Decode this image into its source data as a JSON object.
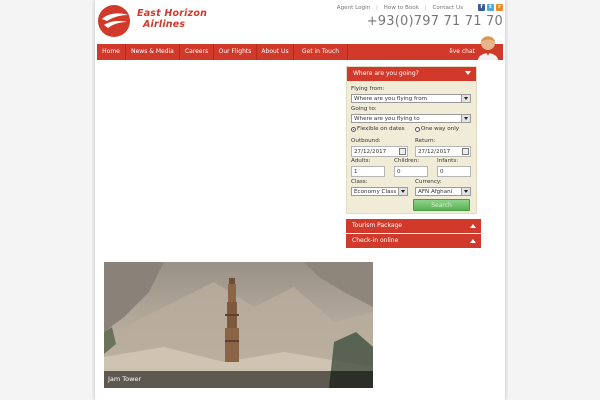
{
  "brand": {
    "line1": "East Horizon",
    "line2": "Airlines"
  },
  "toplinks": [
    "Agent Login",
    "How to Book",
    "Contact Us"
  ],
  "social": [
    {
      "name": "facebook-icon",
      "glyph": "f",
      "color": "#3b5998"
    },
    {
      "name": "twitter-icon",
      "glyph": "t",
      "color": "#4ea9dd"
    },
    {
      "name": "rss-icon",
      "glyph": "r",
      "color": "#f08a24"
    }
  ],
  "phone": "+93(0)797 71 71 70",
  "nav": [
    "Home",
    "News & Media",
    "Careers",
    "Our Flights",
    "About Us",
    "Get in Touch"
  ],
  "livechat": "live chat",
  "booking": {
    "title": "Where are you going?",
    "from_label": "Flying from:",
    "from_value": "Where are you flying from",
    "to_label": "Going to:",
    "to_value": "Where are you flying to",
    "flexible_label": "Flexible on dates",
    "oneway_label": "One way only",
    "outbound_label": "Outbound:",
    "outbound_value": "27/12/2017",
    "return_label": "Return:",
    "return_value": "27/12/2017",
    "adults_label": "Adults:",
    "adults_value": "1",
    "children_label": "Children:",
    "children_value": "0",
    "infants_label": "Infants:",
    "infants_value": "0",
    "class_label": "Class:",
    "class_value": "Economy Class",
    "currency_label": "Currency:",
    "currency_value": "AFN Afghani",
    "search_label": "Search"
  },
  "accordion": [
    "Tourism Package",
    "Check-in online"
  ],
  "photo": {
    "caption": "Jam Tower"
  },
  "colors": {
    "accent": "#d13a2a",
    "green": "#5bb254",
    "formbg": "#f1ecd8"
  }
}
